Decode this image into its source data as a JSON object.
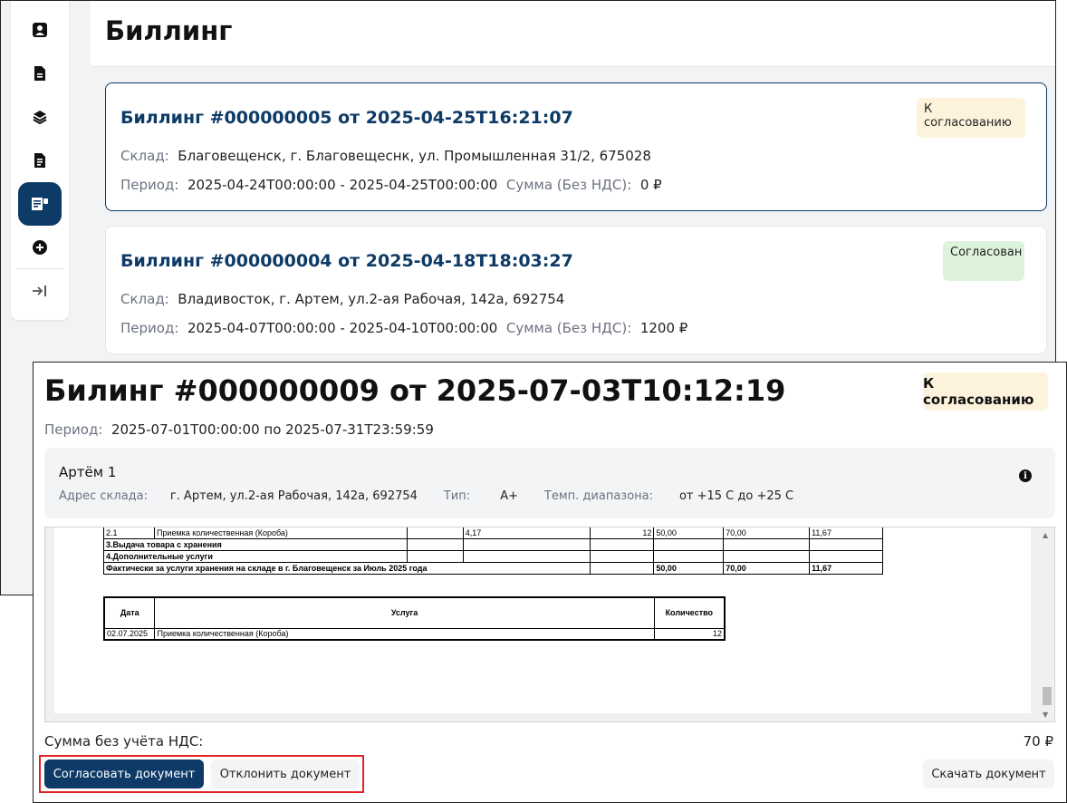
{
  "page": {
    "title": "Биллинг"
  },
  "sidebar": {
    "items": [
      {
        "icon": "contact-icon"
      },
      {
        "icon": "document-icon"
      },
      {
        "icon": "layers-icon"
      },
      {
        "icon": "document-list-icon"
      },
      {
        "icon": "billing-icon",
        "active": true
      },
      {
        "icon": "add-circle-icon"
      },
      {
        "icon": "expand-sidebar-icon"
      }
    ]
  },
  "cards": [
    {
      "title": "Биллинг #000000005 от 2025-04-25T16:21:07",
      "status": "К согласованию",
      "warehouse_label": "Склад:",
      "warehouse": "Благовещенск, г. Благовещеснк, ул. Промышленная 31/2, 675028",
      "period_label": "Период:",
      "period": "2025-04-24T00:00:00 - 2025-04-25T00:00:00",
      "sum_label": "Сумма (Без НДС):",
      "sum": "0 ₽"
    },
    {
      "title": "Биллинг #000000004 от 2025-04-18T18:03:27",
      "status": "Согласован",
      "warehouse_label": "Склад:",
      "warehouse": "Владивосток, г. Артем, ул.2-ая Рабочая, 142а, 692754",
      "period_label": "Период:",
      "period": "2025-04-07T00:00:00 - 2025-04-10T00:00:00",
      "sum_label": "Сумма (Без НДС):",
      "sum": "1200 ₽"
    }
  ],
  "modal": {
    "title": "Билинг #000000009 от 2025-07-03T10:12:19",
    "status": "К согласованию",
    "period_label": "Период:",
    "period": "2025-07-01T00:00:00 по 2025-07-31T23:59:59",
    "warehouse": {
      "name": "Артём 1",
      "address_label": "Адрес склада:",
      "address": "г. Артем, ул.2-ая Рабочая, 142а, 692754",
      "type_label": "Тип:",
      "type": "А+",
      "temp_label": "Темп. диапазона:",
      "temp": "от +15 С до +25 С"
    },
    "document": {
      "table1": [
        [
          "2.1",
          "Приемка количественная (Короба)",
          "",
          "4,17",
          "12",
          "50,00",
          "70,00",
          "11,67"
        ],
        [
          "3.Выдача товара с хранения",
          "",
          "",
          "",
          "",
          "",
          "",
          ""
        ],
        [
          "4.Дополнительные услуги",
          "",
          "",
          "",
          "",
          "",
          "",
          ""
        ],
        [
          "Фактически за услуги хранения на складе в г. Благовещенск за Июль 2025 года",
          "",
          "",
          "",
          "",
          "50,00",
          "70,00",
          "11,67"
        ]
      ],
      "table2": {
        "headers": [
          "Дата",
          "Услуга",
          "Количество"
        ],
        "rows": [
          [
            "02.07.2025",
            "Приемка количественная (Короба)",
            "12"
          ]
        ]
      }
    },
    "sum_label": "Сумма без учёта НДС:",
    "sum": "70 ₽",
    "approve_label": "Согласовать документ",
    "reject_label": "Отклонить документ",
    "download_label": "Скачать документ"
  }
}
